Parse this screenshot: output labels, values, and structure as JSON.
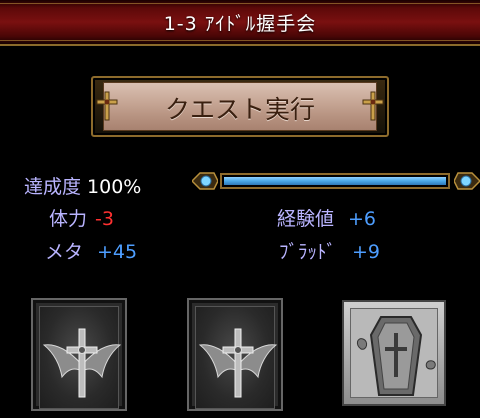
{
  "header": {
    "title": "1-3 ｱｲﾄﾞﾙ握手会"
  },
  "quest_button": {
    "label": "クエスト実行"
  },
  "progress": {
    "label": "達成度",
    "value_text": "100%",
    "fraction": 1.0
  },
  "stats": {
    "stamina": {
      "label": "体力",
      "value": "-3"
    },
    "exp": {
      "label": "経験値",
      "value": "+6"
    },
    "meta": {
      "label": "メタ",
      "value": "+45"
    },
    "blood": {
      "label": "ﾌﾞﾗｯﾄﾞ",
      "value": "+9"
    }
  },
  "rewards": {
    "slots": [
      {
        "icon": "cross-card-back-icon"
      },
      {
        "icon": "cross-card-back-icon"
      },
      {
        "icon": "coffin-item-icon"
      }
    ]
  },
  "colors": {
    "label": "#b9b4ff",
    "positive": "#4e9eff",
    "negative": "#ff3030",
    "gold": "#8d6b2c"
  }
}
